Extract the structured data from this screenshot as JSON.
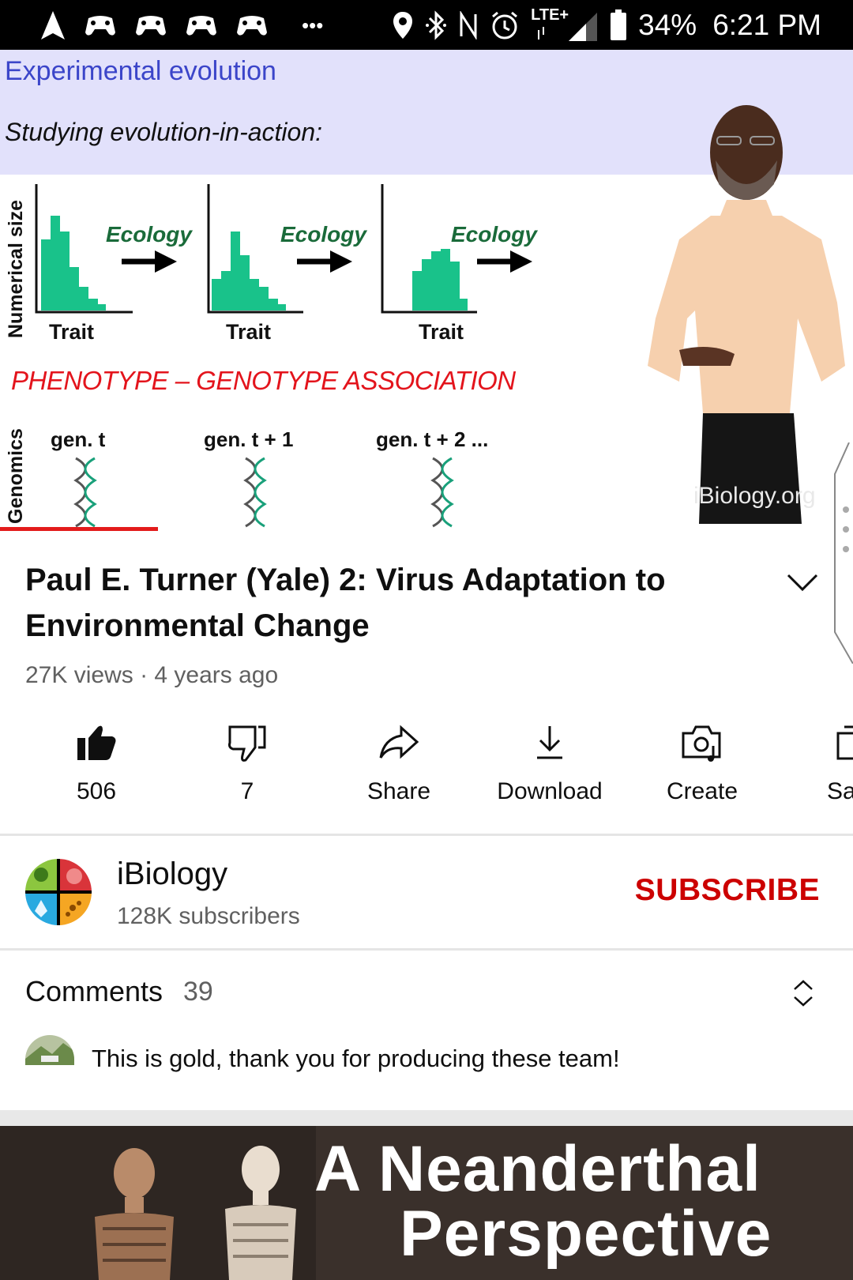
{
  "status_bar": {
    "battery": "34%",
    "time": "6:21 PM",
    "network": "LTE+",
    "overflow": "•••"
  },
  "video": {
    "slide_title": "Experimental evolution",
    "slide_subtitle": "Studying evolution-in-action:",
    "y_label_top": "Numerical size",
    "y_label_bottom": "Genomics",
    "ecology_labels": [
      "Ecology",
      "Ecology",
      "Ecology"
    ],
    "trait_labels": [
      "Trait",
      "Trait",
      "Trait"
    ],
    "association": "PHENOTYPE – GENOTYPE ASSOCIATION",
    "generations": [
      "gen. t",
      "gen. t + 1",
      "gen. t + 2 ..."
    ],
    "watermark": "iBiology.org",
    "progress_fraction": 0.185,
    "colors": {
      "bars": "#19c28a",
      "assoc": "#e3141c",
      "header_bg": "#e2e1fb"
    }
  },
  "meta": {
    "title": "Paul E. Turner (Yale) 2: Virus Adaptation to Environmental Change",
    "views": "27K views · 4 years ago"
  },
  "actions": [
    {
      "name": "like",
      "label": "506",
      "icon": "thumbs-up-filled-icon"
    },
    {
      "name": "dislike",
      "label": "7",
      "icon": "thumbs-down-icon"
    },
    {
      "name": "share",
      "label": "Share",
      "icon": "share-arrow-icon"
    },
    {
      "name": "download",
      "label": "Download",
      "icon": "download-icon"
    },
    {
      "name": "create",
      "label": "Create",
      "icon": "create-camera-icon"
    },
    {
      "name": "save",
      "label": "Sa",
      "icon": "save-playlist-icon"
    }
  ],
  "channel": {
    "name": "iBiology",
    "subscribers": "128K subscribers",
    "subscribe_label": "SUBSCRIBE",
    "subscribe_color": "#cc0000"
  },
  "comments": {
    "header": "Comments",
    "count": "39",
    "top_comment": "This is gold, thank you for producing these team!"
  },
  "next_video": {
    "title_line1": "A Neanderthal",
    "title_line2": "Perspective"
  }
}
